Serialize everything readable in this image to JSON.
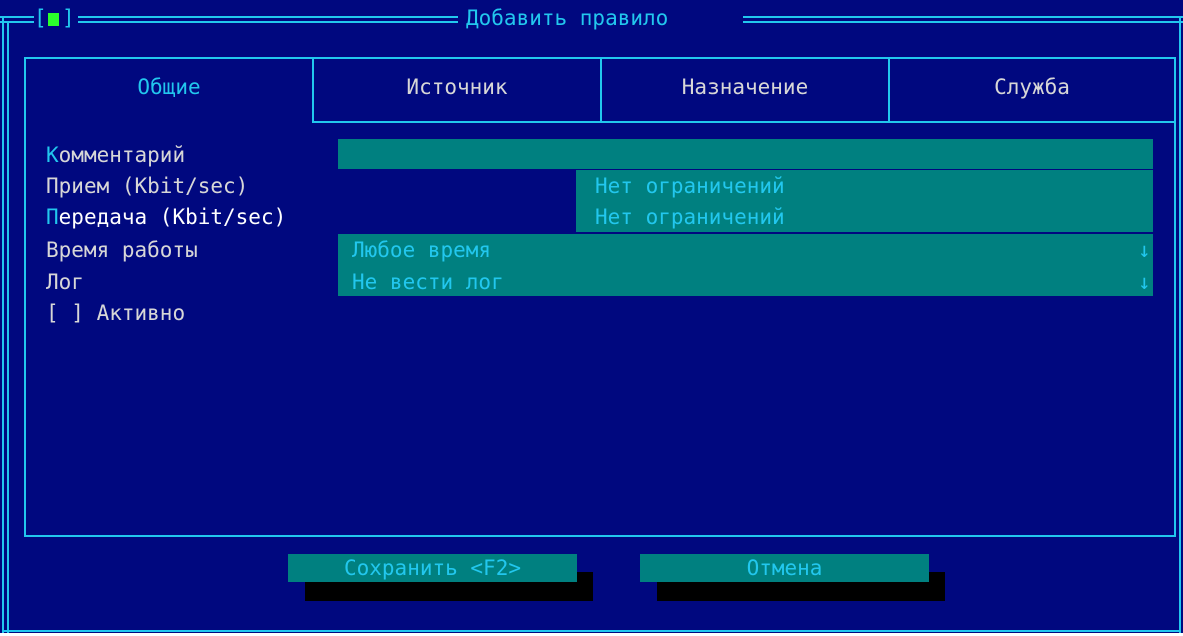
{
  "dialog": {
    "title": "Добавить правило",
    "close_left": "[",
    "close_right": "]"
  },
  "tabs": [
    {
      "label": "Общие",
      "active": true
    },
    {
      "label": "Источник",
      "active": false
    },
    {
      "label": "Назначение",
      "active": false
    },
    {
      "label": "Служба",
      "active": false
    }
  ],
  "form": {
    "comment": {
      "hotkey": "К",
      "rest": "омментарий",
      "value": ""
    },
    "receive": {
      "hotkey": "П",
      "rest": "рием (Kbit/sec)",
      "value": "",
      "hint": "Нет ограничений"
    },
    "transmit": {
      "hotkey": "П",
      "rest": "ередача (Kbit/sec)",
      "value": "",
      "hint": "Нет ограничений"
    },
    "schedule": {
      "hotkey": "",
      "rest": "Время работы",
      "value": "Любое время",
      "arrow": "↓"
    },
    "log": {
      "hotkey": "",
      "rest": "Лог",
      "value": "Не вести лог",
      "arrow": "↓"
    },
    "active": {
      "checkbox": "[ ]",
      "label": "Активно",
      "checked": false
    }
  },
  "buttons": {
    "save": "Сохранить <F2>",
    "cancel": "Отмена"
  },
  "colors": {
    "background": "#00087f",
    "accent": "#22c7ee",
    "field": "#008080",
    "close_indicator": "#2bff2b"
  }
}
